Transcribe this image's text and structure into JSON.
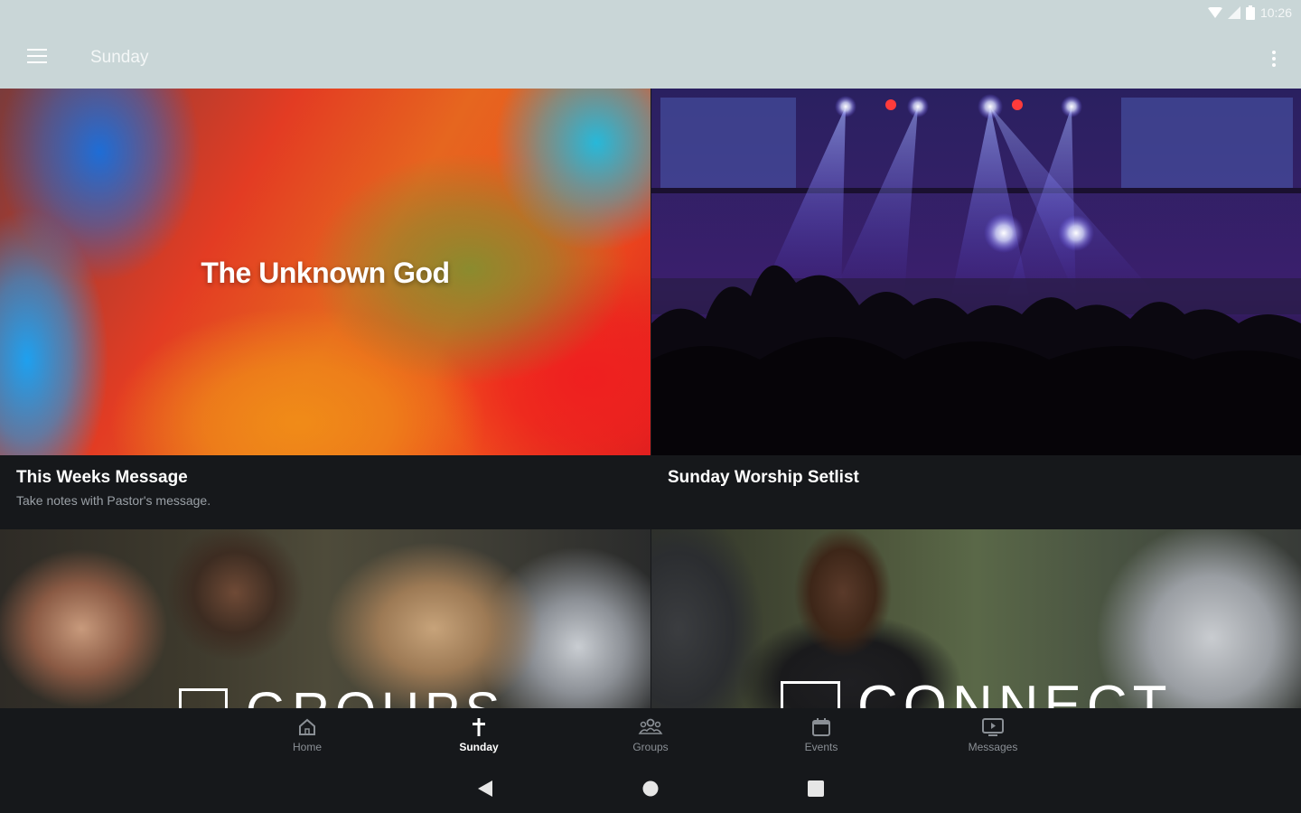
{
  "status_bar": {
    "time": "10:26"
  },
  "app_bar": {
    "title": "Sunday"
  },
  "cards": [
    {
      "title": "This Weeks Message",
      "subtitle": "Take notes with Pastor's message.",
      "image_title": "The Unknown God"
    },
    {
      "title": "Sunday Worship Setlist"
    },
    {
      "image_word": "GROUPS"
    },
    {
      "image_word": "CONNECT"
    }
  ],
  "bottom_nav": {
    "items": [
      {
        "label": "Home",
        "icon": "home-icon"
      },
      {
        "label": "Sunday",
        "icon": "cross-icon",
        "active": true
      },
      {
        "label": "Groups",
        "icon": "groups-icon"
      },
      {
        "label": "Events",
        "icon": "calendar-icon"
      },
      {
        "label": "Messages",
        "icon": "tv-icon"
      }
    ]
  },
  "system_nav": {
    "buttons": [
      "back-icon",
      "home-circle-icon",
      "recents-icon"
    ]
  },
  "colors": {
    "app_bar": "#c9d6d7",
    "background": "#16181b",
    "text": "#ffffff",
    "muted": "#8a8f95"
  }
}
